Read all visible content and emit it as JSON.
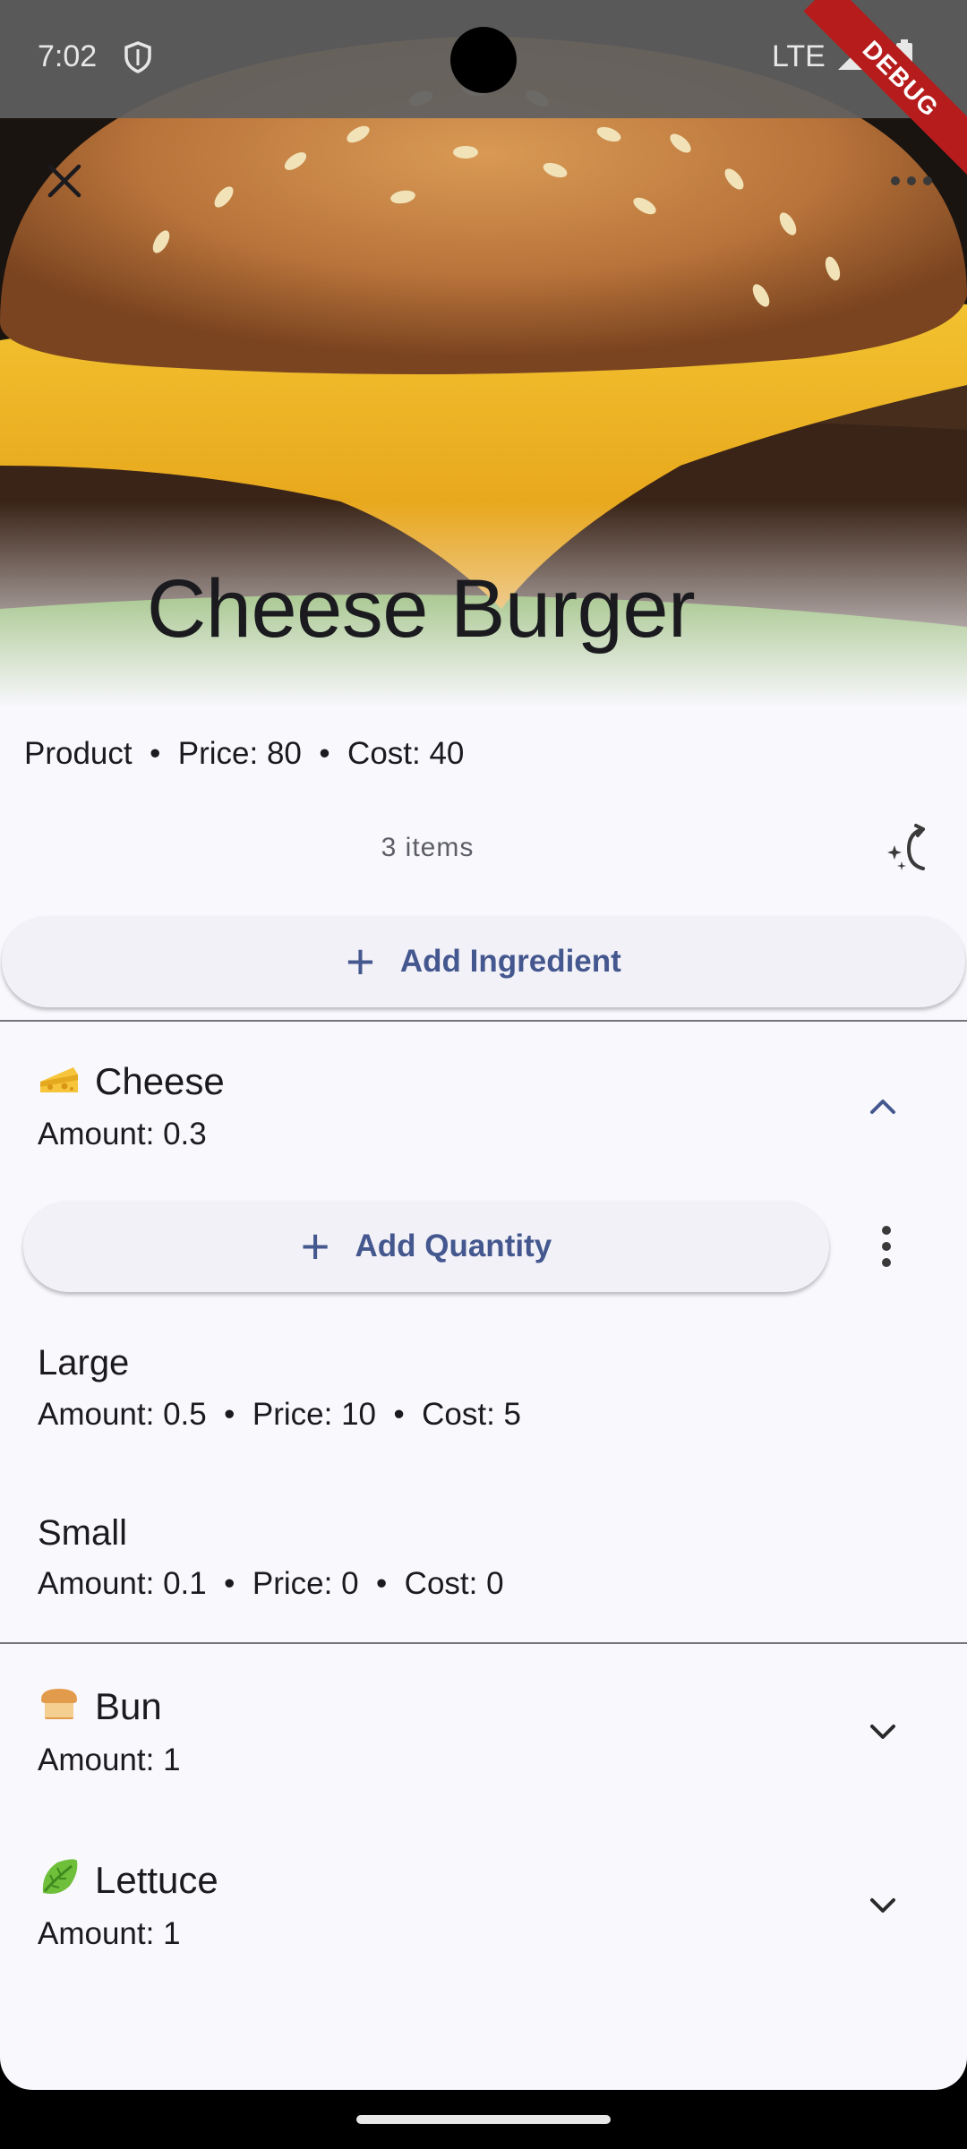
{
  "status_bar": {
    "time": "7:02",
    "network": "LTE",
    "debug_label": "DEBUG"
  },
  "product": {
    "title": "Cheese Burger",
    "meta": "Product  •  Price: 80  •  Cost: 40",
    "items_count": "3 items"
  },
  "actions": {
    "add_ingredient": "Add Ingredient",
    "add_quantity": "Add Quantity"
  },
  "ingredients": [
    {
      "name": "Cheese",
      "amount": "Amount: 0.3",
      "icon": "cheese-icon",
      "expanded": true,
      "quantities": [
        {
          "name": "Large",
          "detail": "Amount: 0.5  •  Price: 10  •  Cost: 5"
        },
        {
          "name": "Small",
          "detail": "Amount: 0.1  •  Price: 0  •  Cost: 0"
        }
      ]
    },
    {
      "name": "Bun",
      "amount": "Amount: 1",
      "icon": "bread-icon",
      "expanded": false
    },
    {
      "name": "Lettuce",
      "amount": "Amount: 1",
      "icon": "leafy-green-icon",
      "expanded": false
    }
  ],
  "colors": {
    "accent": "#44588f",
    "background": "#f9f8fd",
    "divider": "#76767c"
  }
}
